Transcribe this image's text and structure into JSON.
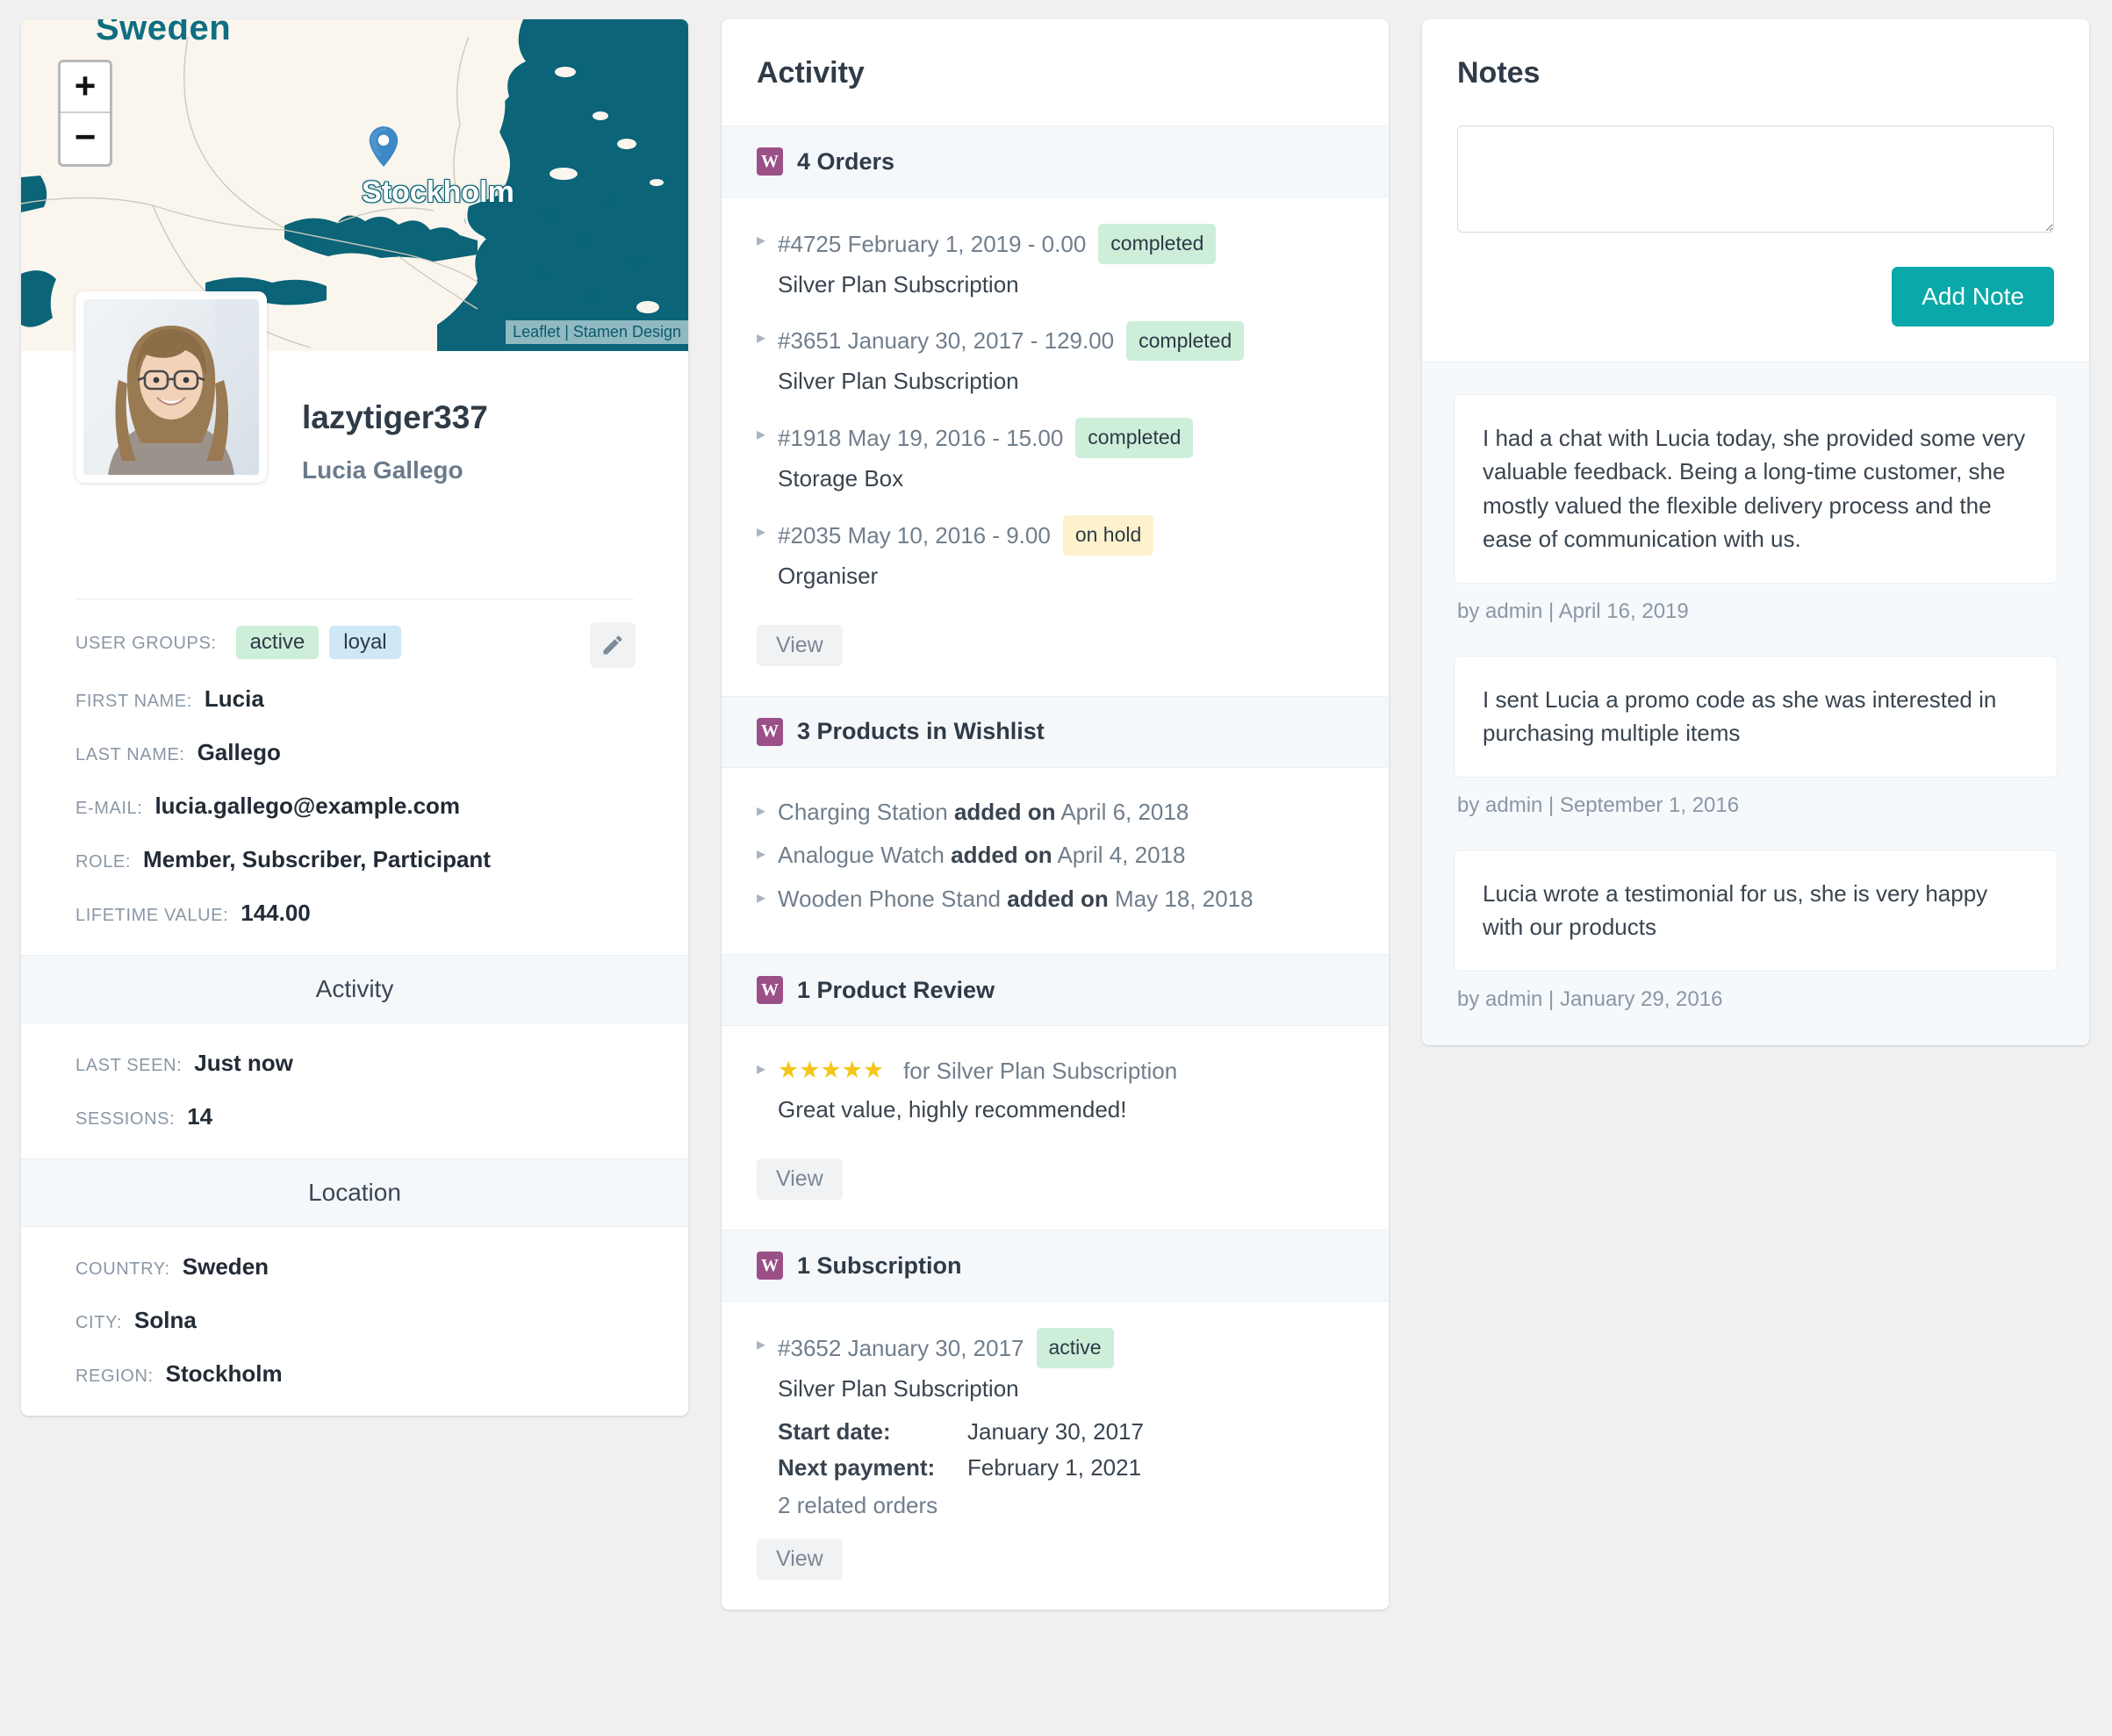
{
  "map": {
    "country_label": "Sweden",
    "city_label": "Stockholm",
    "zoom_in_label": "+",
    "zoom_out_label": "−",
    "attribution_leaflet": "Leaflet",
    "attribution_separator": "|",
    "attribution_provider": "Stamen Design",
    "land_color": "#faf6ee",
    "water_color": "#0b6478",
    "pin_color": "#3d88c6"
  },
  "profile": {
    "username": "lazytiger337",
    "full_name": "Lucia Gallego",
    "edit_icon": "pencil-icon",
    "fields": [
      {
        "label": "USER GROUPS:",
        "type": "tags",
        "tags": [
          {
            "text": "active",
            "color": "#cdeed9"
          },
          {
            "text": "loyal",
            "color": "#cfe7f7"
          }
        ]
      },
      {
        "label": "FIRST NAME:",
        "value": "Lucia"
      },
      {
        "label": "LAST NAME:",
        "value": "Gallego"
      },
      {
        "label": "E-MAIL:",
        "value": "lucia.gallego@example.com"
      },
      {
        "label": "ROLE:",
        "value": "Member, Subscriber, Participant"
      },
      {
        "label": "LIFETIME VALUE:",
        "value": "144.00"
      }
    ],
    "activity_section": {
      "title": "Activity",
      "fields": [
        {
          "label": "LAST SEEN:",
          "value": "Just now"
        },
        {
          "label": "SESSIONS:",
          "value": "14"
        }
      ]
    },
    "location_section": {
      "title": "Location",
      "fields": [
        {
          "label": "COUNTRY:",
          "value": "Sweden"
        },
        {
          "label": "CITY:",
          "value": "Solna"
        },
        {
          "label": "REGION:",
          "value": "Stockholm"
        }
      ]
    }
  },
  "activity": {
    "title": "Activity",
    "orders": {
      "icon": "woocommerce-icon",
      "heading": "4 Orders",
      "items": [
        {
          "ref": "#4725 February 1, 2019 - 0.00",
          "status": "completed",
          "status_kind": "completed",
          "product": "Silver Plan Subscription"
        },
        {
          "ref": "#3651 January 30, 2017 - 129.00",
          "status": "completed",
          "status_kind": "completed",
          "product": "Silver Plan Subscription"
        },
        {
          "ref": "#1918 May 19, 2016 - 15.00",
          "status": "completed",
          "status_kind": "completed",
          "product": "Storage Box"
        },
        {
          "ref": "#2035 May 10, 2016 - 9.00",
          "status": "on hold",
          "status_kind": "onhold",
          "product": "Organiser"
        }
      ],
      "view_label": "View"
    },
    "wishlist": {
      "icon": "woocommerce-icon",
      "heading": "3 Products in Wishlist",
      "items": [
        {
          "product": "Charging Station",
          "connector": "added on",
          "date": "April 6, 2018"
        },
        {
          "product": "Analogue Watch",
          "connector": "added on",
          "date": "April 4, 2018"
        },
        {
          "product": "Wooden Phone Stand",
          "connector": "added on",
          "date": "May 18, 2018"
        }
      ]
    },
    "review": {
      "icon": "woocommerce-icon",
      "heading": "1 Product Review",
      "stars": "★★★★★",
      "rating": 5,
      "for_text": "for Silver Plan Subscription",
      "body": "Great value, highly recommended!",
      "view_label": "View"
    },
    "subscription": {
      "icon": "woocommerce-icon",
      "heading": "1 Subscription",
      "ref": "#3652 January 30, 2017",
      "status": "active",
      "product": "Silver Plan Subscription",
      "start_date_label": "Start date:",
      "start_date": "January 30, 2017",
      "next_payment_label": "Next payment:",
      "next_payment": "February 1, 2021",
      "related_orders": "2 related orders",
      "view_label": "View"
    }
  },
  "notes": {
    "title": "Notes",
    "textarea_value": "",
    "textarea_placeholder": "",
    "add_button_label": "Add Note",
    "add_button_color": "#0aa8a8",
    "items": [
      {
        "body": "I had a chat with Lucia today, she provided some very valuable feedback. Being a long-time customer, she mostly valued the flexible delivery process and the ease of communication with us.",
        "meta": "by admin | April 16, 2019"
      },
      {
        "body": "I sent Lucia a promo code as she was interested in purchasing multiple items",
        "meta": "by admin | September 1, 2016"
      },
      {
        "body": "Lucia wrote a testimonial for us, she is very happy with our products",
        "meta": "by admin | January 29, 2016"
      }
    ]
  }
}
